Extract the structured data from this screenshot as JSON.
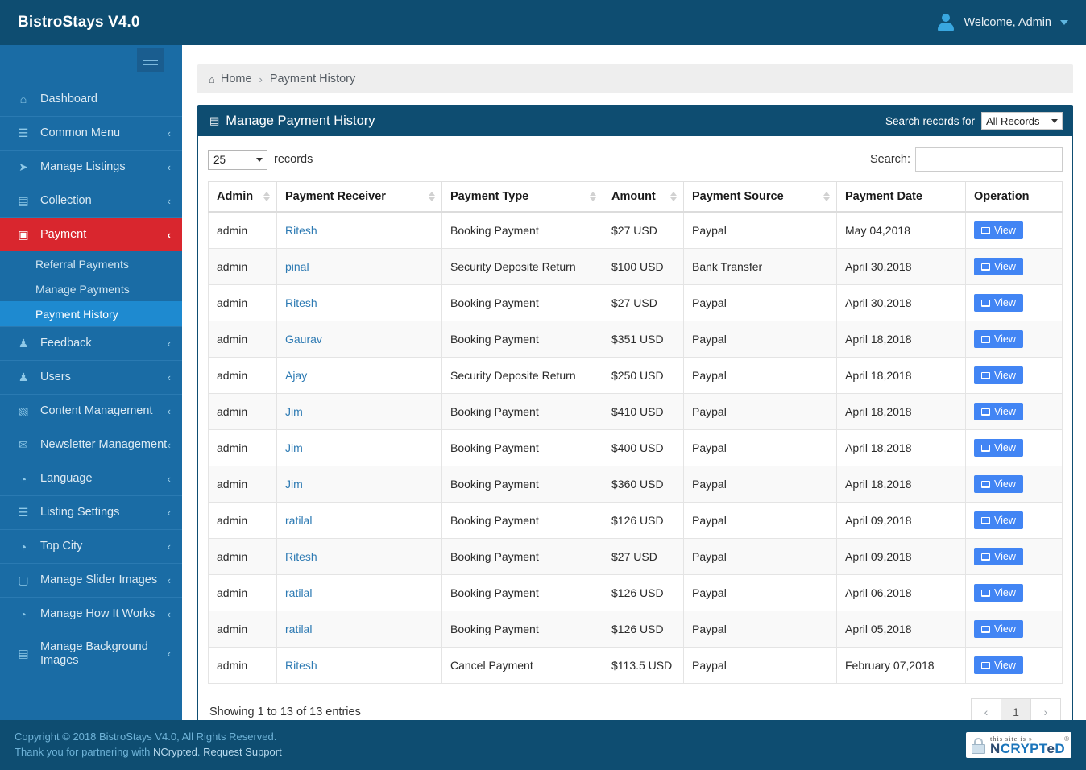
{
  "topbar": {
    "brand": "BistroStays V4.0",
    "user_label": "Welcome, Admin"
  },
  "sidebar": {
    "items": [
      {
        "label": "Dashboard",
        "icon": "home-icon",
        "glyph": "⌂",
        "arrow": "",
        "active": false
      },
      {
        "label": "Common Menu",
        "icon": "list-icon",
        "glyph": "☰",
        "arrow": "‹",
        "active": false
      },
      {
        "label": "Manage Listings",
        "icon": "paper-plane-icon",
        "glyph": "➤",
        "arrow": "‹",
        "active": false
      },
      {
        "label": "Collection",
        "icon": "window-icon",
        "glyph": "▤",
        "arrow": "‹",
        "active": false
      },
      {
        "label": "Payment",
        "icon": "money-icon",
        "glyph": "▣",
        "arrow": "‹",
        "active": true
      },
      {
        "label": "Feedback",
        "icon": "users-icon",
        "glyph": "♟",
        "arrow": "‹",
        "active": false
      },
      {
        "label": "Users",
        "icon": "users-icon",
        "glyph": "♟",
        "arrow": "‹",
        "active": false
      },
      {
        "label": "Content Management",
        "icon": "file-icon",
        "glyph": "▧",
        "arrow": "‹",
        "active": false
      },
      {
        "label": "Newsletter Management",
        "icon": "envelope-icon",
        "glyph": "✉",
        "arrow": "‹",
        "active": false
      },
      {
        "label": "Language",
        "icon": "globe-icon",
        "glyph": "◔",
        "arrow": "‹",
        "active": false
      },
      {
        "label": "Listing Settings",
        "icon": "list-icon",
        "glyph": "☰",
        "arrow": "‹",
        "active": false
      },
      {
        "label": "Top City",
        "icon": "globe-icon",
        "glyph": "◔",
        "arrow": "‹",
        "active": false
      },
      {
        "label": "Manage Slider Images",
        "icon": "monitor-icon",
        "glyph": "▢",
        "arrow": "‹",
        "active": false
      },
      {
        "label": "Manage How It Works",
        "icon": "globe-icon",
        "glyph": "◔",
        "arrow": "‹",
        "active": false
      },
      {
        "label": "Manage Background Images",
        "icon": "file-word-icon",
        "glyph": "▤",
        "arrow": "‹",
        "active": false
      }
    ],
    "payment_submenu": [
      {
        "label": "Referral Payments",
        "active": false
      },
      {
        "label": "Manage Payments",
        "active": false
      },
      {
        "label": "Payment History",
        "active": true
      }
    ]
  },
  "breadcrumb": {
    "home": "Home",
    "separator": "›",
    "current": "Payment History"
  },
  "panel": {
    "title": "Manage Payment History",
    "search_records_label": "Search records for",
    "search_records_value": "All Records",
    "search_records_options": [
      "All Records"
    ]
  },
  "controls": {
    "length_value": "25",
    "length_options": [
      "25"
    ],
    "records_label": "records",
    "search_label": "Search:",
    "search_value": "",
    "search_placeholder": ""
  },
  "table": {
    "columns": [
      {
        "label": "Admin",
        "sortable": true
      },
      {
        "label": "Payment Receiver",
        "sortable": true
      },
      {
        "label": "Payment Type",
        "sortable": true
      },
      {
        "label": "Amount",
        "sortable": true
      },
      {
        "label": "Payment Source",
        "sortable": true
      },
      {
        "label": "Payment Date",
        "sortable": false
      },
      {
        "label": "Operation",
        "sortable": false
      }
    ],
    "action_label": "View",
    "rows": [
      {
        "admin": "admin",
        "receiver": "Ritesh",
        "type": "Booking Payment",
        "amount": "$27 USD",
        "source": "Paypal",
        "date": "May 04,2018"
      },
      {
        "admin": "admin",
        "receiver": "pinal",
        "type": "Security Deposite Return",
        "amount": "$100 USD",
        "source": "Bank Transfer",
        "date": "April 30,2018"
      },
      {
        "admin": "admin",
        "receiver": "Ritesh",
        "type": "Booking Payment",
        "amount": "$27 USD",
        "source": "Paypal",
        "date": "April 30,2018"
      },
      {
        "admin": "admin",
        "receiver": "Gaurav",
        "type": "Booking Payment",
        "amount": "$351 USD",
        "source": "Paypal",
        "date": "April 18,2018"
      },
      {
        "admin": "admin",
        "receiver": "Ajay",
        "type": "Security Deposite Return",
        "amount": "$250 USD",
        "source": "Paypal",
        "date": "April 18,2018"
      },
      {
        "admin": "admin",
        "receiver": "Jim",
        "type": "Booking Payment",
        "amount": "$410 USD",
        "source": "Paypal",
        "date": "April 18,2018"
      },
      {
        "admin": "admin",
        "receiver": "Jim",
        "type": "Booking Payment",
        "amount": "$400 USD",
        "source": "Paypal",
        "date": "April 18,2018"
      },
      {
        "admin": "admin",
        "receiver": "Jim",
        "type": "Booking Payment",
        "amount": "$360 USD",
        "source": "Paypal",
        "date": "April 18,2018"
      },
      {
        "admin": "admin",
        "receiver": "ratilal",
        "type": "Booking Payment",
        "amount": "$126 USD",
        "source": "Paypal",
        "date": "April 09,2018"
      },
      {
        "admin": "admin",
        "receiver": "Ritesh",
        "type": "Booking Payment",
        "amount": "$27 USD",
        "source": "Paypal",
        "date": "April 09,2018"
      },
      {
        "admin": "admin",
        "receiver": "ratilal",
        "type": "Booking Payment",
        "amount": "$126 USD",
        "source": "Paypal",
        "date": "April 06,2018"
      },
      {
        "admin": "admin",
        "receiver": "ratilal",
        "type": "Booking Payment",
        "amount": "$126 USD",
        "source": "Paypal",
        "date": "April 05,2018"
      },
      {
        "admin": "admin",
        "receiver": "Ritesh",
        "type": "Cancel Payment",
        "amount": "$113.5 USD",
        "source": "Paypal",
        "date": "February 07,2018"
      }
    ]
  },
  "pagination": {
    "showing": "Showing 1 to 13 of 13 entries",
    "prev": "‹",
    "next": "›",
    "pages": [
      "1"
    ],
    "current_page": "1"
  },
  "footer": {
    "copyright": "Copyright © 2018 BistroStays V4.0, All Rights Reserved.",
    "partner_prefix": "Thank you for partnering with ",
    "partner_name": "NCrypted",
    "partner_sep": ". ",
    "support_link": "Request Support",
    "badge_top": "this site is »",
    "badge_main_a": "N",
    "badge_main_b": "CRYPT",
    "badge_main_c": "e",
    "badge_main_d": "D",
    "badge_reg": "®"
  },
  "colors": {
    "topbar": "#0e4d71",
    "sidebar": "#1a6ca5",
    "active_nav": "#d9262e",
    "active_sub": "#1e8ad0",
    "panel_header": "#0e4d71",
    "action_button": "#4285f4",
    "link": "#2d7ab3"
  }
}
